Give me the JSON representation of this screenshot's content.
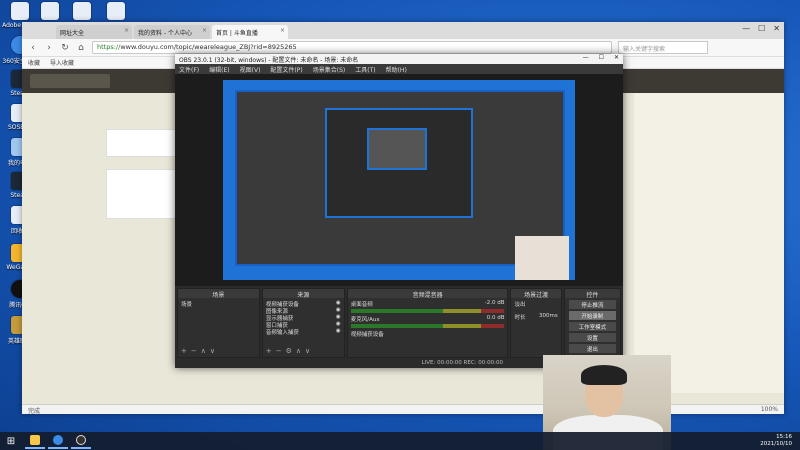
{
  "desktop": {
    "icons": [
      {
        "label": "Adobe Acr..."
      },
      {
        "label": "360安全浏..."
      },
      {
        "label": "Steam"
      },
      {
        "label": "SOSEXE"
      },
      {
        "label": "我的电脑"
      },
      {
        "label": "Steam"
      },
      {
        "label": "回收站"
      },
      {
        "label": "WeGame"
      },
      {
        "label": "腾讯QQ"
      },
      {
        "label": "英雄联盟"
      }
    ]
  },
  "browser": {
    "tabs": [
      {
        "label": "网址大全"
      },
      {
        "label": "我的资料 - 个人中心"
      },
      {
        "label": "首页 | 斗鱼直播"
      }
    ],
    "url_scheme": "https://",
    "url_rest": "www.douyu.com/topic/weareleague_ZBJ?rid=8925265",
    "search_placeholder": "输入关键字搜索",
    "bookmarks": [
      "收藏",
      "导入收藏"
    ],
    "status_left": "完成",
    "status_right": "100%"
  },
  "obs": {
    "title": "OBS 23.0.1 (32-bit, windows) - 配置文件: 未命名 - 场景: 未命名",
    "menu": [
      "文件(F)",
      "编辑(E)",
      "视图(V)",
      "配置文件(P)",
      "场景集合(S)",
      "工具(T)",
      "帮助(H)"
    ],
    "docks": {
      "scenes": {
        "title": "场景",
        "items": [
          "场景"
        ]
      },
      "sources": {
        "title": "来源",
        "items": [
          "视频捕获设备",
          "图像来源",
          "显示器捕获",
          "窗口捕获",
          "音频输入捕获"
        ]
      },
      "mixer": {
        "title": "音频混音器",
        "channels": [
          {
            "name": "桌面音频",
            "db": "-2.0 dB"
          },
          {
            "name": "麦克风/Aux",
            "db": "0.0 dB"
          },
          {
            "name": "视频捕获设备",
            "db": ""
          }
        ]
      },
      "transitions": {
        "title": "场景过渡",
        "type": "淡出",
        "duration_label": "时长",
        "duration": "300ms"
      },
      "controls": {
        "title": "控件",
        "buttons": [
          "停止推流",
          "开始录制",
          "工作室模式",
          "设置",
          "退出"
        ]
      }
    },
    "status": "LIVE: 00:00:00   REC: 00:00:00"
  },
  "taskbar": {
    "time": "15:16",
    "date": "2021/10/10"
  }
}
